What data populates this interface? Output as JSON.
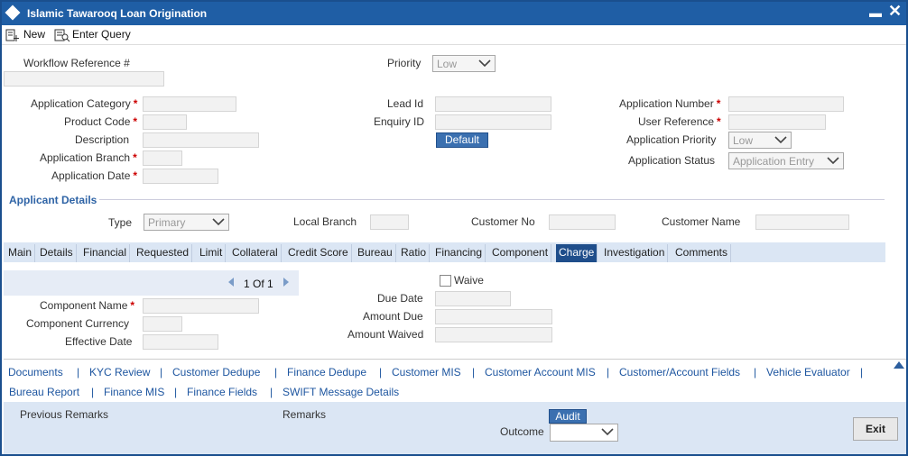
{
  "window": {
    "title": "Islamic Tawarooq Loan Origination",
    "minimize_glyph": "▬",
    "close_glyph": "✕"
  },
  "toolbar": {
    "new_label": "New",
    "enter_query_label": "Enter Query"
  },
  "header": {
    "workflow_ref_label": "Workflow Reference #",
    "priority_label": "Priority",
    "priority_value": "Low"
  },
  "form": {
    "app_category_label": "Application Category",
    "product_code_label": "Product Code",
    "description_label": "Description",
    "app_branch_label": "Application Branch",
    "app_date_label": "Application Date",
    "lead_id_label": "Lead Id",
    "enquiry_id_label": "Enquiry ID",
    "default_button": "Default",
    "app_number_label": "Application Number",
    "user_ref_label": "User Reference",
    "app_priority_label": "Application Priority",
    "app_priority_value": "Low",
    "app_status_label": "Application Status",
    "app_status_value": "Application Entry",
    "required_mark": "*"
  },
  "applicant": {
    "section_title": "Applicant Details",
    "type_label": "Type",
    "type_value": "Primary",
    "local_branch_label": "Local Branch",
    "customer_no_label": "Customer No",
    "customer_name_label": "Customer Name"
  },
  "tabs": [
    {
      "label": "Main"
    },
    {
      "label": "Details"
    },
    {
      "label": "Financial"
    },
    {
      "label": "Requested"
    },
    {
      "label": "Limit"
    },
    {
      "label": "Collateral"
    },
    {
      "label": "Credit Score"
    },
    {
      "label": "Bureau"
    },
    {
      "label": "Ratio"
    },
    {
      "label": "Financing"
    },
    {
      "label": "Component"
    },
    {
      "label": "Charge"
    },
    {
      "label": "Investigation"
    },
    {
      "label": "Comments"
    }
  ],
  "charge": {
    "pager_current": "1",
    "pager_of": "Of",
    "pager_total": "1",
    "waive_label": "Waive",
    "component_name_label": "Component Name",
    "component_currency_label": "Component Currency",
    "effective_date_label": "Effective Date",
    "due_date_label": "Due Date",
    "amount_due_label": "Amount Due",
    "amount_waived_label": "Amount Waived"
  },
  "links": {
    "row1": [
      "Documents",
      "KYC Review",
      "Customer Dedupe",
      "Finance Dedupe",
      "Customer MIS",
      "Customer Account MIS",
      "Customer/Account Fields",
      "Vehicle Evaluator"
    ],
    "row2": [
      "Bureau Report",
      "Finance MIS",
      "Finance Fields",
      "SWIFT Message Details"
    ],
    "separator": "|"
  },
  "footer": {
    "previous_remarks_label": "Previous Remarks",
    "remarks_label": "Remarks",
    "audit_button": "Audit",
    "outcome_label": "Outcome",
    "exit_button": "Exit"
  },
  "colors": {
    "title_bar": "#1f5ea5",
    "active_tab": "#1f4e8b",
    "link": "#1e56a0",
    "required": "#cc0000"
  }
}
